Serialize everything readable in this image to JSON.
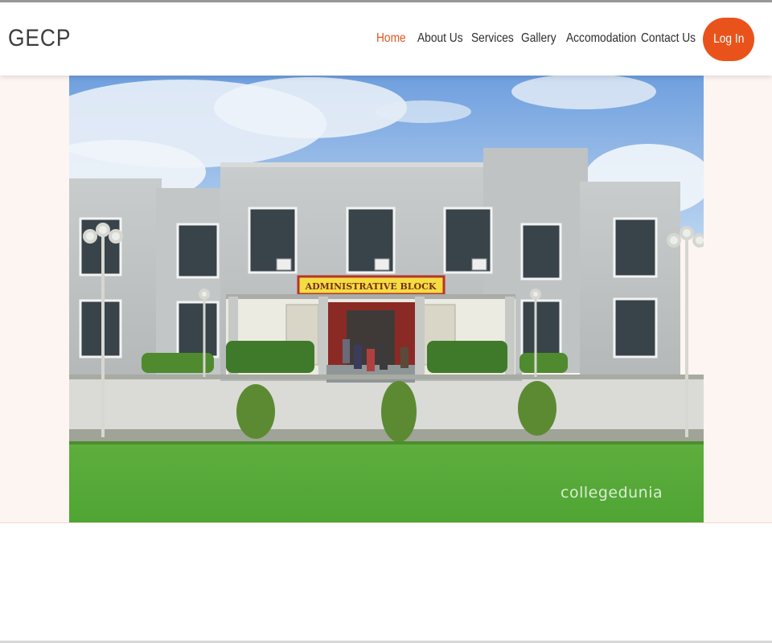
{
  "brand": "GECP",
  "nav": {
    "items": [
      "Home",
      "About Us",
      "Services",
      "Gallery",
      "Accomodation",
      "Contact Us"
    ],
    "active": "Home",
    "login_label": "Log In"
  },
  "hero": {
    "sign_text": "ADMINISTRATIVE BLOCK",
    "watermark": "collegedunia"
  },
  "colors": {
    "accent": "#e9531b",
    "active_link": "#e2561c",
    "hero_band": "#fdf5f1"
  }
}
